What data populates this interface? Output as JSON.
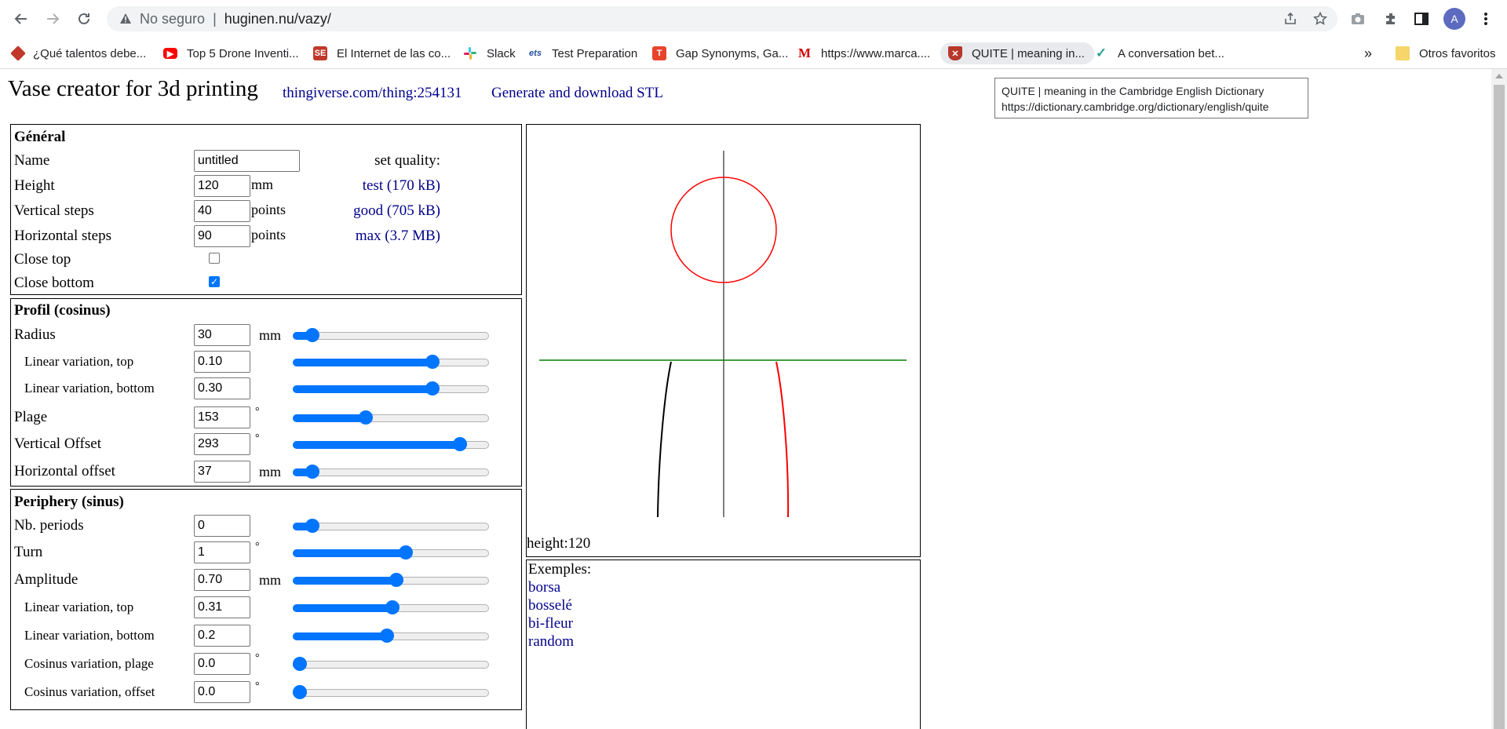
{
  "browser": {
    "security_label": "No seguro",
    "url": "huginen.nu/vazy/",
    "profile_initial": "A",
    "bookmarks": [
      {
        "label": "¿Qué talentos debe...",
        "icon": "diamond-icon",
        "color": "#c0392b"
      },
      {
        "label": "Top 5 Drone Inventi...",
        "icon": "youtube-icon",
        "color": "#ff0000"
      },
      {
        "label": "El Internet de las co...",
        "icon": "se-icon",
        "color": "#c0392b"
      },
      {
        "label": "Slack",
        "icon": "slack-icon",
        "color": "#4a154b"
      },
      {
        "label": "Test Preparation",
        "icon": "ets-icon",
        "color": "#1f4e9a"
      },
      {
        "label": "Gap Synonyms, Ga...",
        "icon": "t-icon",
        "color": "#e8442c"
      },
      {
        "label": "https://www.marca....",
        "icon": "marca-icon",
        "color": "#d40000"
      },
      {
        "label": "QUITE | meaning in...",
        "icon": "cambridge-icon",
        "color": "#b8372b"
      },
      {
        "label": "A conversation bet...",
        "icon": "check-icon",
        "color": "#2aa198"
      }
    ],
    "more_label": "»",
    "other_bookmarks": "Otros favoritos"
  },
  "tooltip": {
    "title": "QUITE | meaning in the Cambridge English Dictionary",
    "url": "https://dictionary.cambridge.org/dictionary/english/quite"
  },
  "header": {
    "title": "Vase creator for 3d printing",
    "thingiverse_link": "thingiverse.com/thing:254131",
    "generate_link": "Generate and download STL"
  },
  "general": {
    "title": "Général",
    "name_label": "Name",
    "name_value": "untitled",
    "height_label": "Height",
    "height_value": "120",
    "height_unit": "mm",
    "vsteps_label": "Vertical steps",
    "vsteps_value": "40",
    "vsteps_unit": "points",
    "hsteps_label": "Horizontal steps",
    "hsteps_value": "90",
    "hsteps_unit": "points",
    "close_top_label": "Close top",
    "close_top_checked": false,
    "close_bottom_label": "Close bottom",
    "close_bottom_checked": true,
    "quality_label": "set quality:",
    "quality_test": "test (170 kB)",
    "quality_good": "good (705 kB)",
    "quality_max": "max (3.7 MB)"
  },
  "profil": {
    "title": "Profil (cosinus)",
    "rows": [
      {
        "label": "Radius",
        "value": "30",
        "unit": "mm",
        "slider": 0.07,
        "sub": false
      },
      {
        "label": "Linear variation, top",
        "value": "0.10",
        "unit": "",
        "slider": 0.73,
        "sub": true
      },
      {
        "label": "Linear variation, bottom",
        "value": "0.30",
        "unit": "",
        "slider": 0.73,
        "sub": true
      },
      {
        "label": "Plage",
        "value": "153",
        "unit": "°",
        "slider": 0.36,
        "sub": false
      },
      {
        "label": "Vertical Offset",
        "value": "293",
        "unit": "°",
        "slider": 0.88,
        "sub": false
      },
      {
        "label": "Horizontal offset",
        "value": "37",
        "unit": "mm",
        "slider": 0.07,
        "sub": false
      }
    ]
  },
  "periphery": {
    "title": "Periphery (sinus)",
    "rows": [
      {
        "label": "Nb. periods",
        "value": "0",
        "unit": "",
        "slider": 0.07,
        "sub": false
      },
      {
        "label": "Turn",
        "value": "1",
        "unit": "°",
        "slider": 0.58,
        "sub": false
      },
      {
        "label": "Amplitude",
        "value": "0.70",
        "unit": "mm",
        "slider": 0.53,
        "sub": false
      },
      {
        "label": "Linear variation, top",
        "value": "0.31",
        "unit": "",
        "slider": 0.51,
        "sub": true
      },
      {
        "label": "Linear variation, bottom",
        "value": "0.2",
        "unit": "",
        "slider": 0.48,
        "sub": true
      },
      {
        "label": "Cosinus variation, plage",
        "value": "0.0",
        "unit": "°",
        "slider": 0.0,
        "sub": true
      },
      {
        "label": "Cosinus variation, offset",
        "value": "0.0",
        "unit": "°",
        "slider": 0.0,
        "sub": true
      }
    ]
  },
  "preview": {
    "height_text": "height:120",
    "colors": {
      "axis": "#000000",
      "circle": "#ff0000",
      "base": "#008000",
      "left_profile": "#000000",
      "right_profile": "#ff0000"
    }
  },
  "examples": {
    "title": "Exemples:",
    "items": [
      "borsa",
      "bosselé",
      "bi-fleur",
      "random"
    ]
  }
}
